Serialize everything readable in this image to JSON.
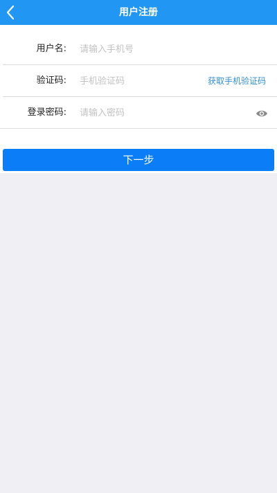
{
  "header": {
    "title": "用户注册",
    "back_icon": "chevron-left-icon"
  },
  "form": {
    "username": {
      "label": "用户名:",
      "placeholder": "请输入手机号",
      "value": ""
    },
    "verify_code": {
      "label": "验证码:",
      "placeholder": "手机验证码",
      "value": "",
      "action_label": "获取手机验证码"
    },
    "password": {
      "label": "登录密码:",
      "placeholder": "请输入密码",
      "value": "",
      "toggle_icon": "eye-icon"
    }
  },
  "next_button": {
    "label": "下一步"
  },
  "colors": {
    "header_bg": "#2196f3",
    "primary_button": "#0a7df7",
    "link": "#2f8fd8",
    "page_bg": "#efeff4"
  }
}
